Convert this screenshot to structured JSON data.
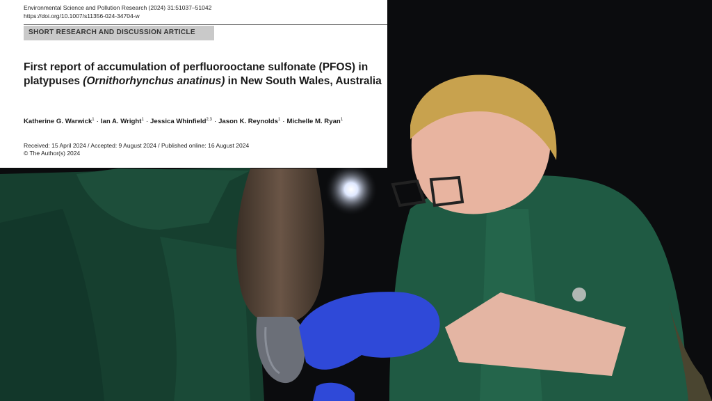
{
  "article": {
    "journal_line": "Environmental Science and Pollution Research (2024) 31:51037–51042",
    "doi": "https://doi.org/10.1007/s11356-024-34704-w",
    "article_type": "SHORT RESEARCH AND DISCUSSION ARTICLE",
    "title_part1": "First report of accumulation of perfluorooctane sulfonate (PFOS) in platypuses ",
    "title_italic": "(Ornithorhynchus anatinus)",
    "title_part2": " in New South Wales, Australia",
    "authors": [
      {
        "name": "Katherine G. Warwick",
        "aff": "1"
      },
      {
        "name": "Ian A. Wright",
        "aff": "1"
      },
      {
        "name": "Jessica Whinfield",
        "aff": "2,3"
      },
      {
        "name": "Jason K. Reynolds",
        "aff": "1"
      },
      {
        "name": "Michelle M. Ryan",
        "aff": "1"
      }
    ],
    "author_separator": "·",
    "dates": "Received: 15 April 2024 / Accepted: 9 August 2024 / Published online: 16 August 2024",
    "copyright": "© The Author(s) 2024"
  },
  "photo": {
    "subject": "night-photo-researchers-examining-platypus",
    "colors": {
      "uniform": "#1f5a43",
      "glove": "#2f49d8",
      "hair": "#c8a24e"
    }
  }
}
